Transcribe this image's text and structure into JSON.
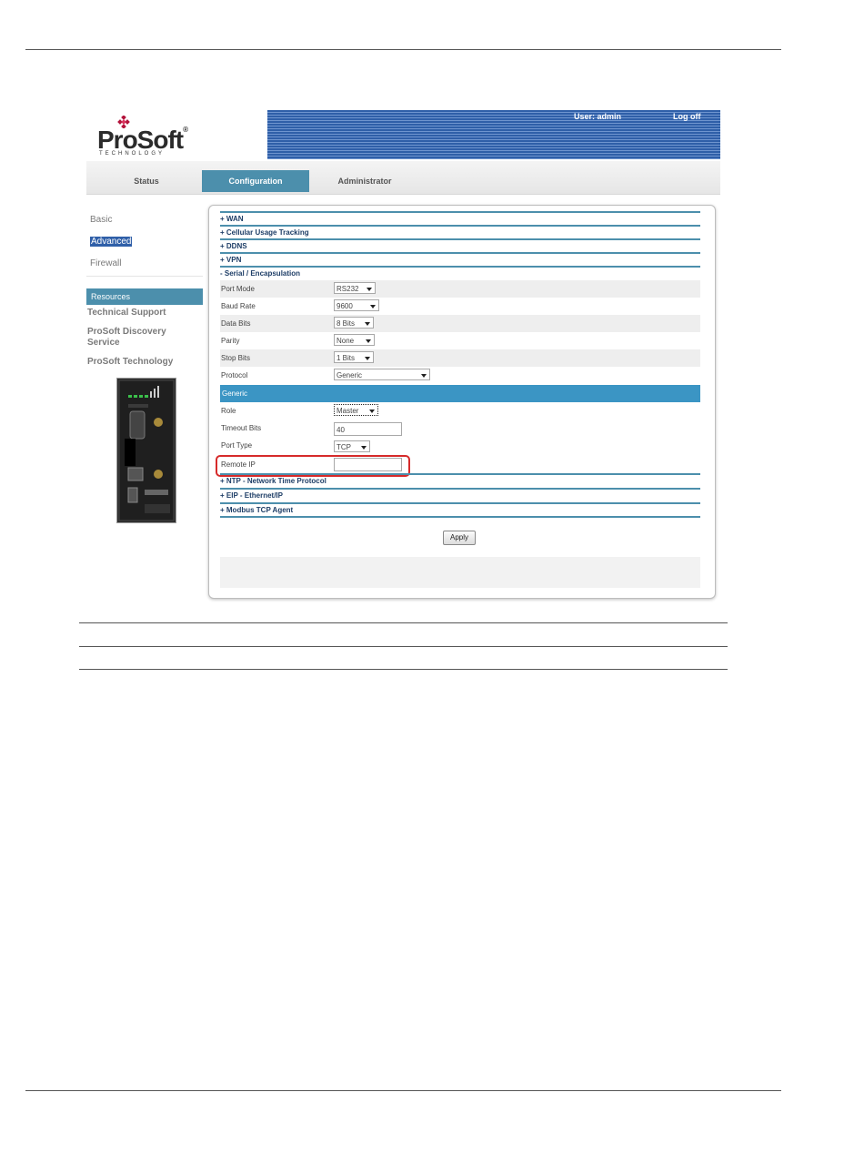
{
  "header": {
    "logo_text": "ProSoft",
    "logo_registered": "®",
    "logo_sub": "TECHNOLOGY",
    "user_label": "User: admin",
    "logoff_label": "Log off"
  },
  "tabs": [
    {
      "label": "Status"
    },
    {
      "label": "Configuration"
    },
    {
      "label": "Administrator"
    }
  ],
  "sidebar": {
    "items": [
      {
        "label": "Basic"
      },
      {
        "label": "Advanced"
      },
      {
        "label": "Firewall"
      }
    ],
    "resources_title": "Resources",
    "resources": [
      {
        "label": "Technical Support"
      },
      {
        "label": "ProSoft Discovery Service"
      },
      {
        "label": "ProSoft Technology"
      }
    ]
  },
  "sections": {
    "wan": "+ WAN",
    "cellular": "+ Cellular Usage Tracking",
    "ddns": "+ DDNS",
    "vpn": "+ VPN",
    "serial": "- Serial / Encapsulation",
    "ntp": "+ NTP - Network Time Protocol",
    "eip": "+ EIP - Ethernet/IP",
    "modbus": "+ Modbus TCP Agent"
  },
  "serial": {
    "port_mode": {
      "label": "Port Mode",
      "value": "RS232"
    },
    "baud_rate": {
      "label": "Baud Rate",
      "value": "9600"
    },
    "data_bits": {
      "label": "Data Bits",
      "value": "8 Bits"
    },
    "parity": {
      "label": "Parity",
      "value": "None"
    },
    "stop_bits": {
      "label": "Stop Bits",
      "value": "1 Bits"
    },
    "protocol": {
      "label": "Protocol",
      "value": "Generic"
    }
  },
  "generic": {
    "title": "Generic",
    "role": {
      "label": "Role",
      "value": "Master"
    },
    "timeout_bits": {
      "label": "Timeout Bits",
      "value": "40"
    },
    "port_type": {
      "label": "Port Type",
      "value": "TCP"
    },
    "remote_ip": {
      "label": "Remote IP",
      "value": ""
    }
  },
  "apply_label": "Apply",
  "colors": {
    "header_blue": "#2f5fa8",
    "accent_teal": "#4c8fac",
    "generic_bar": "#3b95c4",
    "highlight_red": "#d62a2a"
  }
}
